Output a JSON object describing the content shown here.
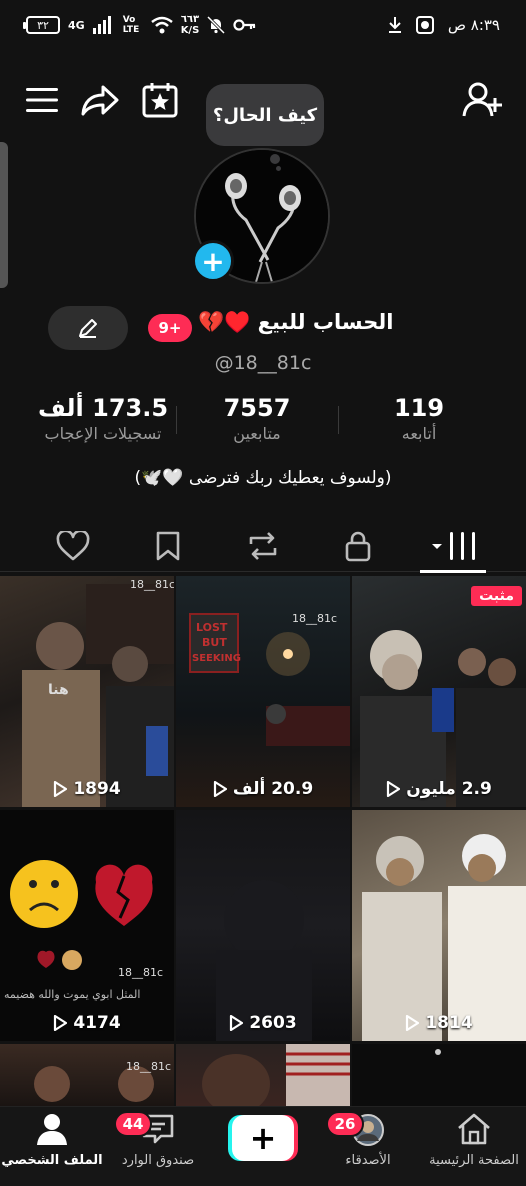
{
  "status_bar": {
    "battery": "٣٢",
    "network": "4G",
    "volte": "Vo LTE",
    "speed": "٦٦٣",
    "speed_unit": "K/S",
    "time": "٨:٣٩ ص"
  },
  "profile": {
    "bubble_text": "كيف الحال؟",
    "display_name": "الحساب للبيع ♥️💔",
    "badge": "9+",
    "username": "@18__81c",
    "bio": "(ولسوف يعطيك ربك فترضى 🤍🕊️)"
  },
  "stats": {
    "following": {
      "value": "119",
      "label": "أتابعه"
    },
    "followers": {
      "value": "7557",
      "label": "متابعين"
    },
    "likes": {
      "value": "173.5 ألف",
      "label": "تسجيلات الإعجاب"
    }
  },
  "videos": [
    {
      "views": "1894",
      "watermark": "18__81c"
    },
    {
      "views": "20.9 ألف",
      "watermark": "18__81c",
      "sign_text": "LOST BUT SEEKING"
    },
    {
      "views": "2.9 مليون",
      "pinned": "مثبت"
    },
    {
      "views": "4174",
      "watermark": "18__81c",
      "caption": "المثل ابوي يموت والله هضيمه"
    },
    {
      "views": "2603"
    },
    {
      "views": "1814"
    }
  ],
  "partial_videos": [
    {
      "watermark": "18__81c"
    }
  ],
  "nav": {
    "profile": "الملف الشخصي",
    "inbox": "صندوق الوارد",
    "inbox_badge": "44",
    "friends": "الأصدقاء",
    "friends_badge": "26",
    "home": "الصفحة الرئيسية"
  },
  "colors": {
    "accent_red": "#fe2c55",
    "accent_cyan": "#25f4ee",
    "add_blue": "#22b8ee"
  }
}
